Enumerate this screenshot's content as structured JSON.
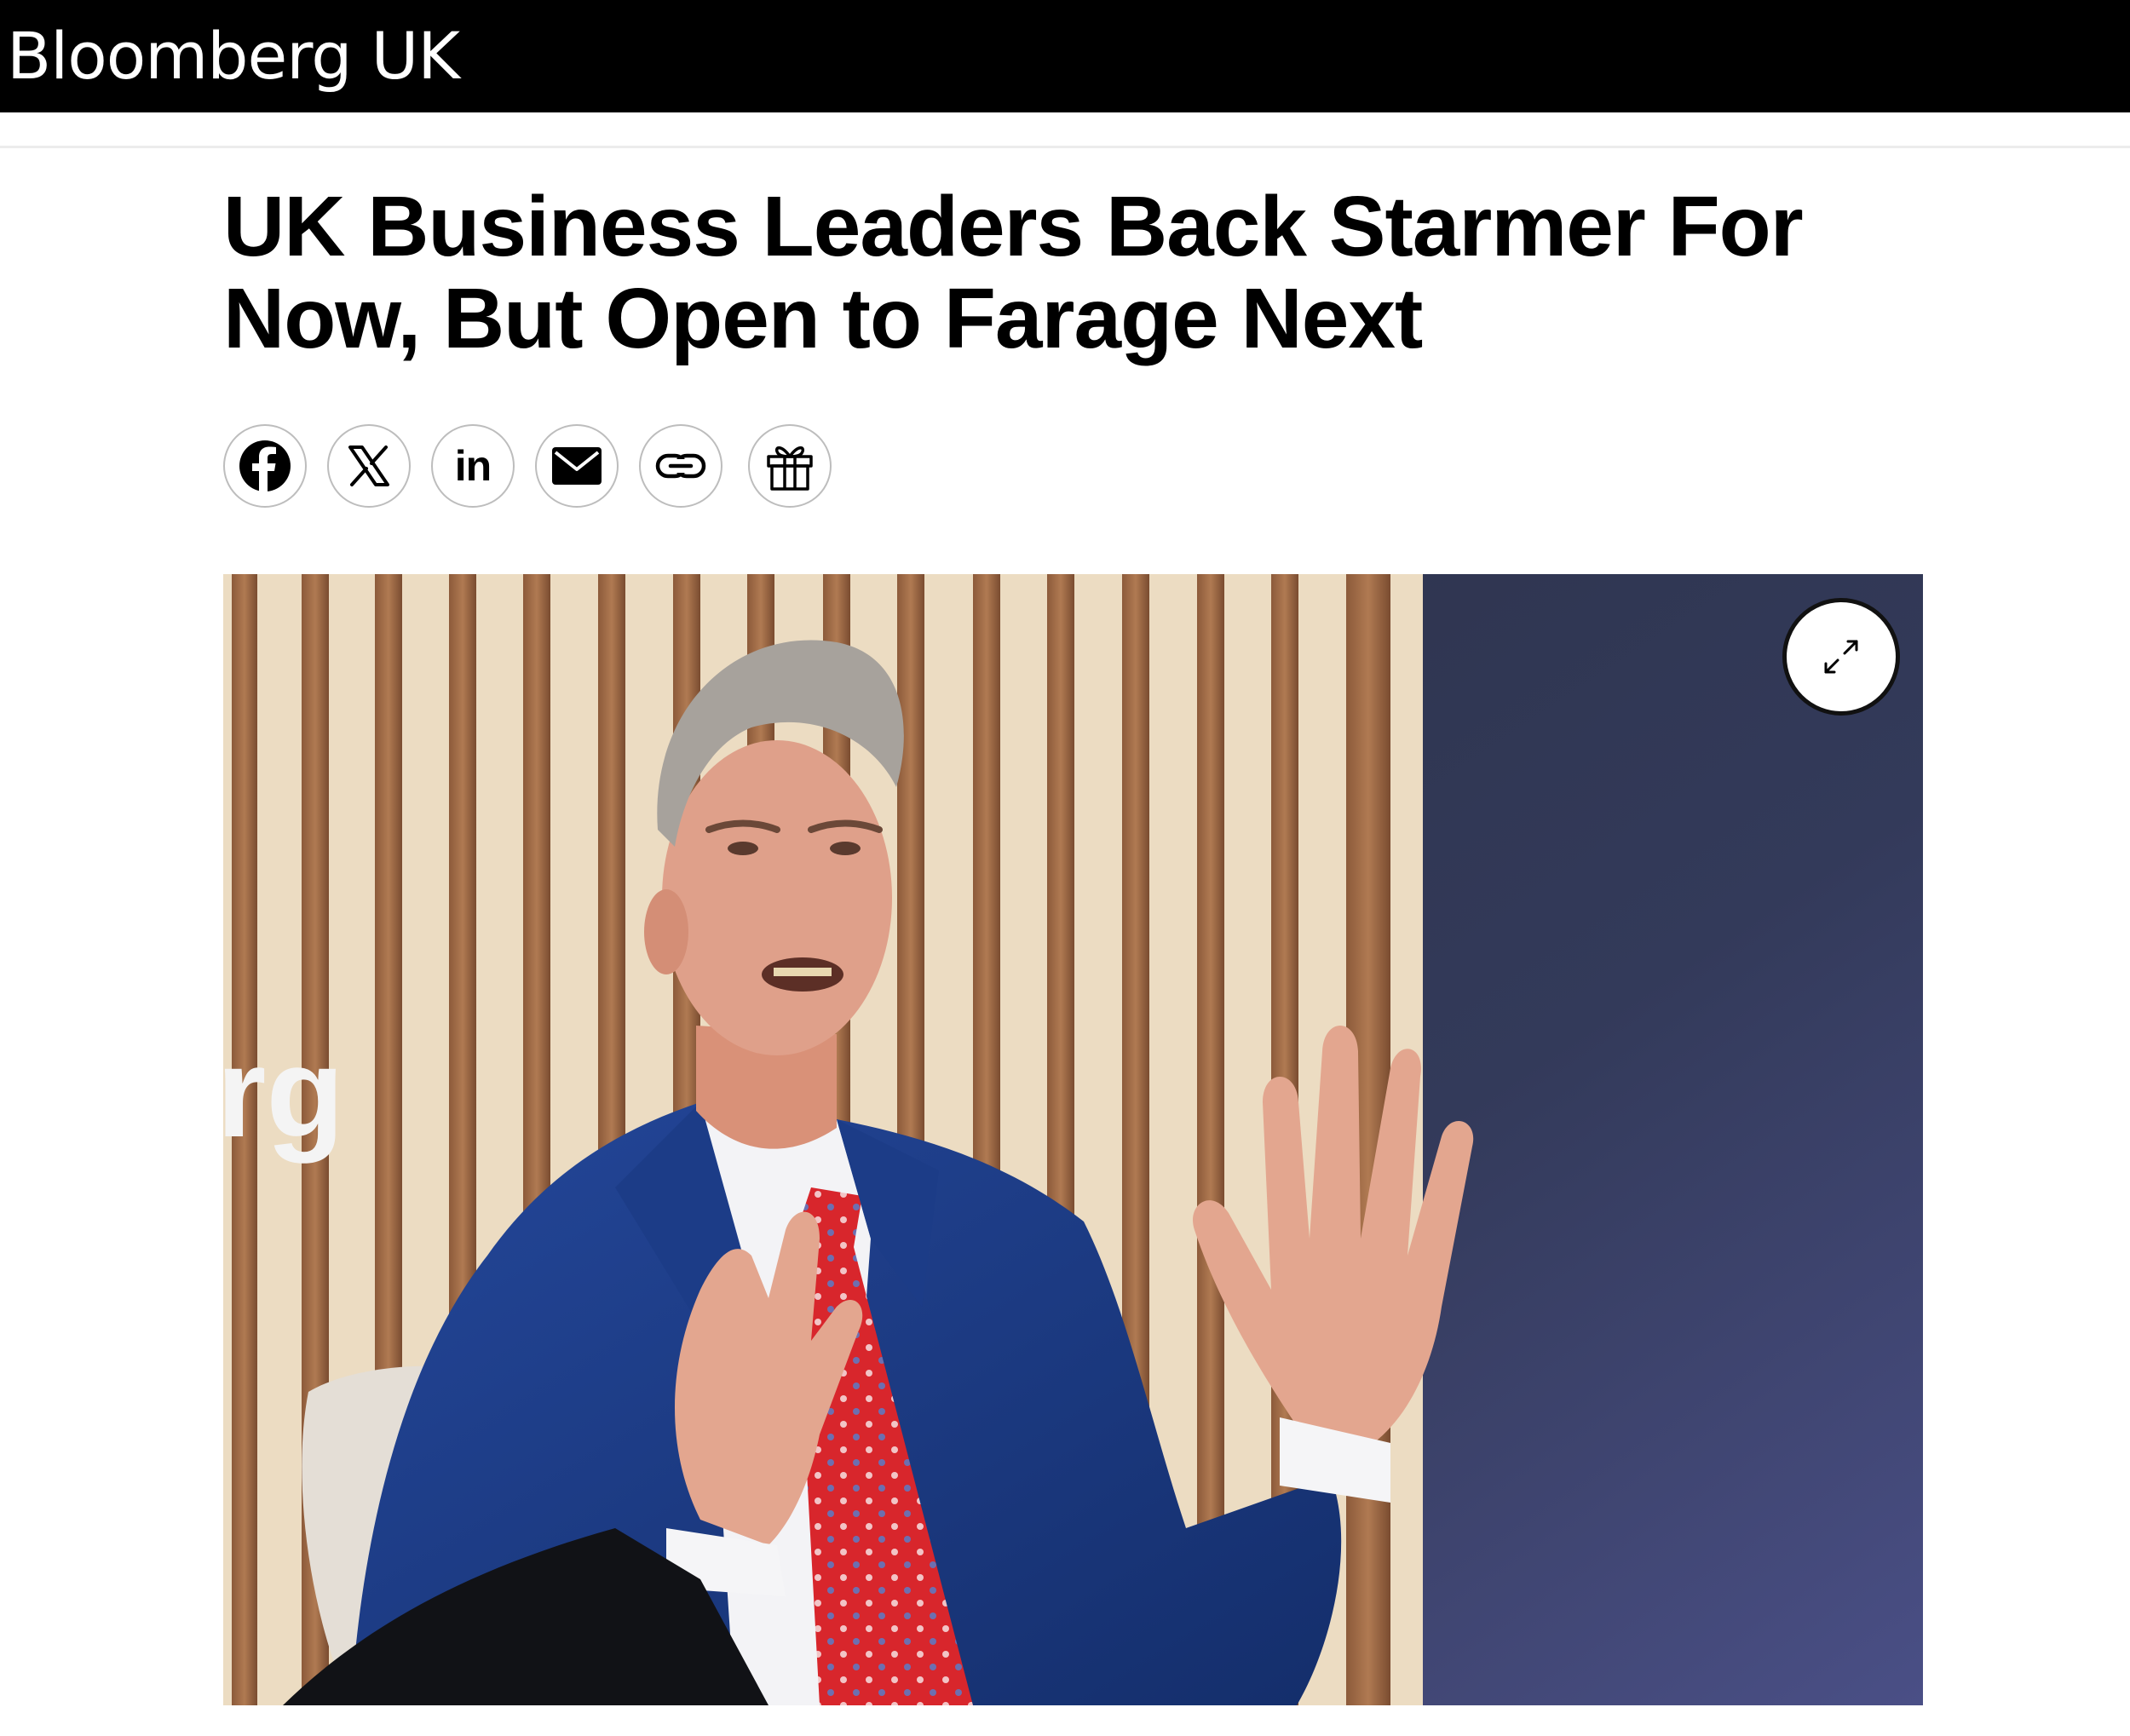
{
  "header": {
    "brand": "Bloomberg UK",
    "background": "#000000"
  },
  "article": {
    "headline": "UK Business Leaders Back Starmer For Now, But Open to Farage Next"
  },
  "share": {
    "buttons": [
      {
        "name": "facebook",
        "icon": "facebook-icon"
      },
      {
        "name": "x",
        "icon": "x-icon"
      },
      {
        "name": "linkedin",
        "icon": "linkedin-icon",
        "text": "in"
      },
      {
        "name": "email",
        "icon": "email-icon"
      },
      {
        "name": "copy-link",
        "icon": "link-icon"
      },
      {
        "name": "gift",
        "icon": "gift-icon"
      }
    ]
  },
  "photo": {
    "backdrop_text": "rg",
    "expand_icon": "expand-icon"
  },
  "colors": {
    "accent": "#000000",
    "tie_red": "#d8262c",
    "suit_blue": "#1d3a86"
  }
}
